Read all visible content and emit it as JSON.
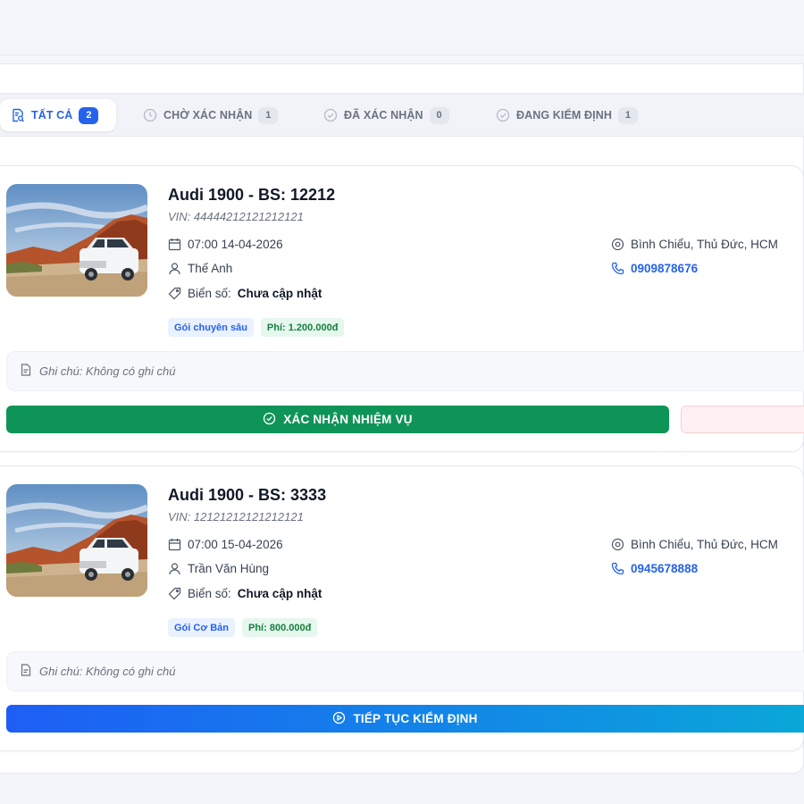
{
  "tabs": [
    {
      "label": "TẤT CẢ",
      "count": "2",
      "icon": "search-doc-icon"
    },
    {
      "label": "CHỜ XÁC NHẬN",
      "count": "1",
      "icon": "clock-icon"
    },
    {
      "label": "ĐÃ XÁC NHẬN",
      "count": "0",
      "icon": "check-circle-icon"
    },
    {
      "label": "ĐANG KIỂM ĐỊNH",
      "count": "1",
      "icon": "check-circle-icon"
    }
  ],
  "orders": [
    {
      "title": "Audi 1900 - BS: 12212",
      "vin": "VIN: 44444212121212121",
      "datetime": "07:00 14-04-2026",
      "customer": "Thế Anh",
      "plate_label": "Biển số:",
      "plate_value": "Chưa cập nhật",
      "location": "Bình Chiểu, Thủ Đức, HCM",
      "phone": "0909878676",
      "package": "Gói chuyên sâu",
      "fee": "Phí: 1.200.000đ",
      "note": "Ghi chú: Không có ghi chú",
      "action": "XÁC NHẬN NHIỆM VỤ"
    },
    {
      "title": "Audi 1900 - BS: 3333",
      "vin": "VIN: 12121212121212121",
      "datetime": "07:00 15-04-2026",
      "customer": "Trần Văn Hùng",
      "plate_label": "Biển số:",
      "plate_value": "Chưa cập nhật",
      "location": "Bình Chiểu, Thủ Đức, HCM",
      "phone": "0945678888",
      "package": "Gói Cơ Bản",
      "fee": "Phí: 800.000đ",
      "note": "Ghi chú: Không có ghi chú",
      "action": "TIẾP TỤC KIỂM ĐỊNH"
    }
  ],
  "colors": {
    "accent": "#2563eb",
    "confirm": "#0f9458",
    "continue_start": "#1e5ef5",
    "continue_end": "#0aa7d8",
    "reject_bg": "#fff1f2"
  }
}
